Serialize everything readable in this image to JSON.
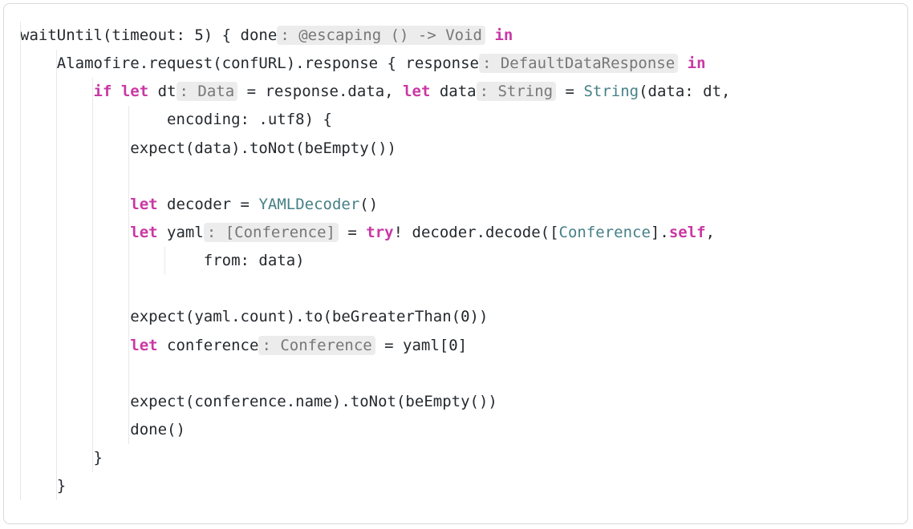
{
  "code": {
    "l1_a": "waitUntil(timeout: ",
    "l1_num": "5",
    "l1_b": ") { done",
    "l1_hint": ": @escaping () -> Void",
    "l1_c": " ",
    "l1_in": "in",
    "l2_a": "    Alamofire.request(confURL).response { response",
    "l2_hint": ": DefaultDataResponse",
    "l2_b": " ",
    "l2_in": "in",
    "l3_a": "        ",
    "l3_if": "if",
    "l3_b": " ",
    "l3_let": "let",
    "l3_c": " dt",
    "l3_hint1": ": Data",
    "l3_d": " = response.data, ",
    "l3_let2": "let",
    "l3_e": " data",
    "l3_hint2": ": String",
    "l3_f": " = ",
    "l3_type": "String",
    "l3_g": "(data: dt,",
    "l4_a": "                encoding: .utf8) {",
    "l5_a": "            expect(data).toNot(beEmpty())",
    "l6_a": "",
    "l7_a": "            ",
    "l7_let": "let",
    "l7_b": " decoder = ",
    "l7_type": "YAMLDecoder",
    "l7_c": "()",
    "l8_a": "            ",
    "l8_let": "let",
    "l8_b": " yaml",
    "l8_hint": ": [Conference]",
    "l8_c": " = ",
    "l8_try": "try",
    "l8_d": "! decoder.decode([",
    "l8_type": "Conference",
    "l8_e": "].",
    "l8_self": "self",
    "l8_f": ",",
    "l9_a": "                    from: data)",
    "l10_a": "",
    "l11_a": "            expect(yaml.count).to(beGreaterThan(",
    "l11_num": "0",
    "l11_b": "))",
    "l12_a": "            ",
    "l12_let": "let",
    "l12_b": " conference",
    "l12_hint": ": Conference",
    "l12_c": " = yaml[",
    "l12_num": "0",
    "l12_d": "]",
    "l13_a": "",
    "l14_a": "            expect(conference.name).toNot(beEmpty())",
    "l15_a": "            done()",
    "l16_a": "        }",
    "l17_a": "    }"
  }
}
